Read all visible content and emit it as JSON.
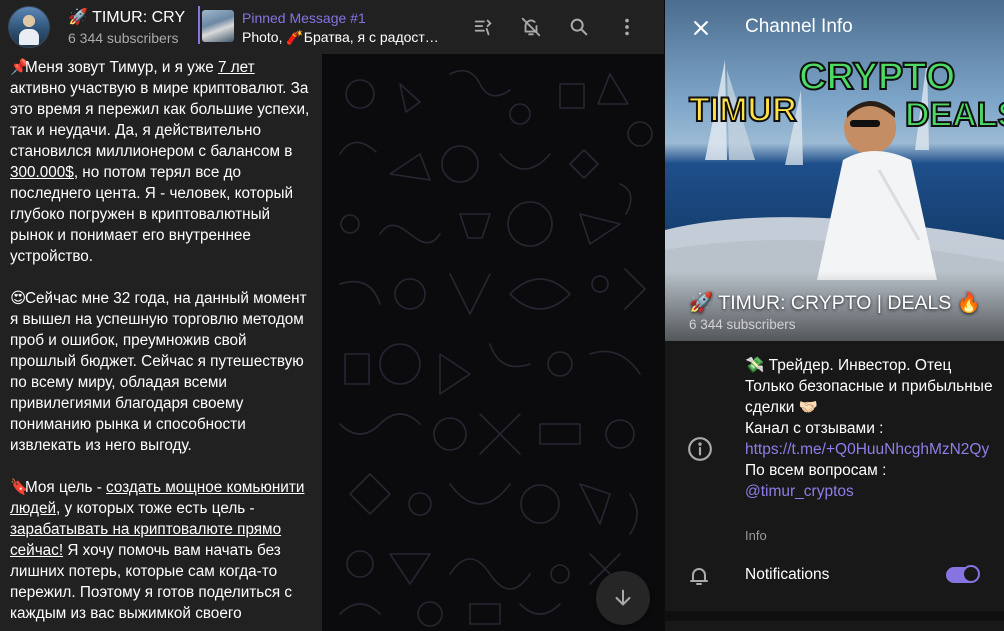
{
  "header": {
    "title": "🚀 TIMUR: CRY",
    "subscribers": "6 344 subscribers",
    "pinned": {
      "title": "Pinned Message #1",
      "snippet": "Photo, 🧨Братва, я с радост…"
    }
  },
  "message": {
    "p1": {
      "emoji": "📌",
      "t1": "Меня зовут Тимур, и я уже ",
      "u1": "7 лет",
      "t2": " активно участвую в мире криптовалют. За это время я пережил как большие успехи, так и неудачи. Да, я действительно становился миллионером с балансом в ",
      "u2": "300.000$",
      "t3": ", но потом терял все до последнего цента. Я - человек, который глубоко погружен в криптовалютный рынок и понимает его внутреннее устройство."
    },
    "p2": {
      "emoji": "😍",
      "text": "Сейчас мне 32 года, на данный момент я вышел на успешную торговлю методом проб и ошибок, преумножив свой прошлый бюджет. Сейчас я путешествую по всему миру, обладая всеми привилегиями благодаря своему пониманию рынка и способности извлекать из него выгоду."
    },
    "p3": {
      "emoji": "🔖",
      "t1": "Моя цель - ",
      "u1": "создать мощное комьюнити людей",
      "t2": ", у которых тоже есть цель - ",
      "u2": "зарабатывать на криптовалюте прямо сейчас!",
      "t3": " Я хочу помочь вам начать без лишних потерь, которые сам когда-то пережил. Поэтому я готов поделиться с каждым из вас выжимкой своего"
    }
  },
  "info_panel": {
    "title": "Channel Info",
    "cover": {
      "name": "🚀 TIMUR: CRYPTO | DEALS 🔥",
      "subscribers": "6 344 subscribers",
      "banner_words": [
        "TIMUR",
        "CRYPTO",
        "DEALS"
      ]
    },
    "about": {
      "line1": "💸 Трейдер. Инвестор. Отец",
      "line2": "Только безопасные и прибыльные сделки 🤝🏻",
      "line3": "Канал с отзывами :",
      "link1": "https://t.me/+Q0HuuNhcghMzN2Qy",
      "line4": "По всем вопросам :",
      "link2": "@timur_cryptos",
      "label": "Info"
    },
    "notifications": {
      "label": "Notifications",
      "enabled": true
    }
  },
  "colors": {
    "accent": "#8774e1",
    "header_bg": "#212121",
    "panel_bg": "#181818"
  },
  "icons": [
    "close-icon",
    "pinned-list-icon",
    "mute-icon",
    "search-icon",
    "more-icon",
    "arrow-down-icon",
    "info-icon",
    "bell-icon"
  ]
}
